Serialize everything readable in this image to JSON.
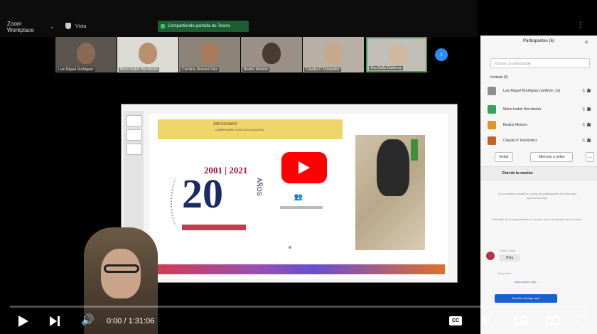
{
  "app": {
    "name": "Zoom Workplace",
    "view_label": "Vista"
  },
  "share_banner": {
    "label": "Compartiendo pantalla de Teams"
  },
  "gallery": {
    "tiles": [
      {
        "name": "Luis Miguel Rodríguez",
        "face_color": "#8a6a52"
      },
      {
        "name": "María Isabel Hernández",
        "face_color": "#b89070"
      },
      {
        "name": "Carolina Jiménez Ruiz",
        "face_color": "#a87a5e"
      },
      {
        "name": "Beatriz Moreno",
        "face_color": "#4a3a30"
      },
      {
        "name": "Claudia P. Fernández",
        "face_color": "#c8a88a"
      },
      {
        "name": "Ana Sofía Gutiérrez",
        "face_color": "#d0b8a0"
      }
    ],
    "next_icon": "chevron-right-icon"
  },
  "slide": {
    "banner_title": "ANIVERSARIO",
    "banner_subtitle": "COMPROMISO CON LA EDUCACIÓN",
    "years": "2001 | 2021",
    "anniversary_number": "20",
    "anniversary_unit": "AÑOS",
    "logo_icon": "people-logo-icon",
    "play_icon": "youtube-play-icon"
  },
  "participants_panel": {
    "title": "Participantes (6)",
    "search_placeholder": "Buscar un participante",
    "section_label": "Invitado (6)",
    "rows": [
      {
        "name": "Luis Miguel Rodríguez (anfitrión, yo)",
        "color": "#8d8d8d",
        "icons": "🎙 🎥"
      },
      {
        "name": "María Isabel Hernández",
        "color": "#3aa060",
        "icons": "🎙 🎥"
      },
      {
        "name": "Beatriz Moreno",
        "color": "#e0922c",
        "icons": "🎙 🎥"
      },
      {
        "name": "Claudia P. Fernández",
        "color": "#c4622a",
        "icons": "🎙 🎥"
      }
    ],
    "invite_label": "Invitar",
    "mute_all_label": "Silenciar a todos",
    "more_label": "…"
  },
  "chat": {
    "title": "Chat de la reunión",
    "system_msg1": "Los mensajes enviados a todos los participantes de la reunión aparecerán aquí.",
    "system_msg2": "Mensajes de chat guardados en la nube con el contenido de la reunión.",
    "sender": "Para: Todos",
    "bubble": "Hola",
    "reply_label": "Responder",
    "link_text": "https://zoom.us/j/…",
    "input_button": "Escribir mensaje aquí"
  },
  "player": {
    "time": "0:00 / 1:31:06",
    "cc_label": "CC",
    "settings_icon": "gear-icon",
    "fullscreen_icon": "fullscreen-icon"
  }
}
